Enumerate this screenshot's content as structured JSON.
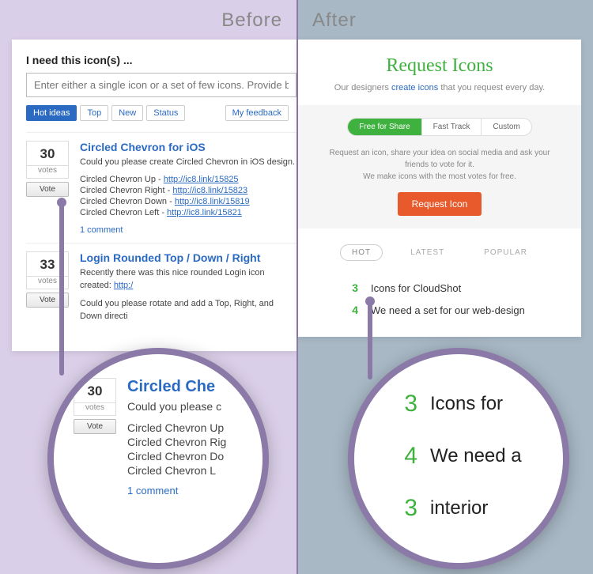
{
  "labels": {
    "before": "Before",
    "after": "After"
  },
  "before": {
    "heading": "I need this icon(s) ...",
    "placeholder": "Enter either a single icon or a set of few icons. Provide bo",
    "tabs": {
      "hot": "Hot ideas",
      "top": "Top",
      "new": "New",
      "status": "Status",
      "my": "My feedback"
    },
    "votes_label": "votes",
    "vote_btn": "Vote",
    "ideas": [
      {
        "votes": "30",
        "title": "Circled Chevron for iOS",
        "desc": "Could you please create Circled Chevron in iOS design.",
        "lines": [
          {
            "pre": "Circled Chevron Up - ",
            "link": "http://ic8.link/15825"
          },
          {
            "pre": "Circled Chevron Right - ",
            "link": "http://ic8.link/15823"
          },
          {
            "pre": "Circled Chevron Down - ",
            "link": "http://ic8.link/15819"
          },
          {
            "pre": "Circled Chevron Left - ",
            "link": "http://ic8.link/15821"
          }
        ],
        "comments": "1 comment"
      },
      {
        "votes": "33",
        "title": "Login Rounded Top / Down / Right",
        "desc_pre": "Recently there was this nice rounded Login icon created: ",
        "desc_link": "http:/",
        "desc2": "Could you please rotate and add a Top, Right, and Down directi"
      }
    ]
  },
  "after": {
    "title": "Request Icons",
    "sub_pre": "Our designers ",
    "sub_link": "create icons",
    "sub_post": " that you request every day.",
    "pills": {
      "free": "Free for Share",
      "fast": "Fast Track",
      "custom": "Custom"
    },
    "note1": "Request an icon, share your idea on social media and ask your friends to vote for it.",
    "note2": "We make icons with the most votes for free.",
    "request_btn": "Request Icon",
    "filters": {
      "hot": "HOT",
      "latest": "LATEST",
      "popular": "POPULAR"
    },
    "items": [
      {
        "n": "3",
        "text": "Icons for CloudShot"
      },
      {
        "n": "4",
        "text": "We need a set for our web-design"
      }
    ]
  },
  "zoom": {
    "left": {
      "votes": "30",
      "title": "Circled Che",
      "desc": "Could you please c",
      "lines": [
        "Circled Chevron Up",
        "Circled Chevron Rig",
        "Circled Chevron Do",
        "Circled Chevron L"
      ],
      "comments": "1 comment"
    },
    "right": {
      "items": [
        {
          "n": "3",
          "text": "Icons for"
        },
        {
          "n": "4",
          "text": "We need a"
        },
        {
          "n": "3",
          "text": "interior"
        }
      ]
    }
  }
}
